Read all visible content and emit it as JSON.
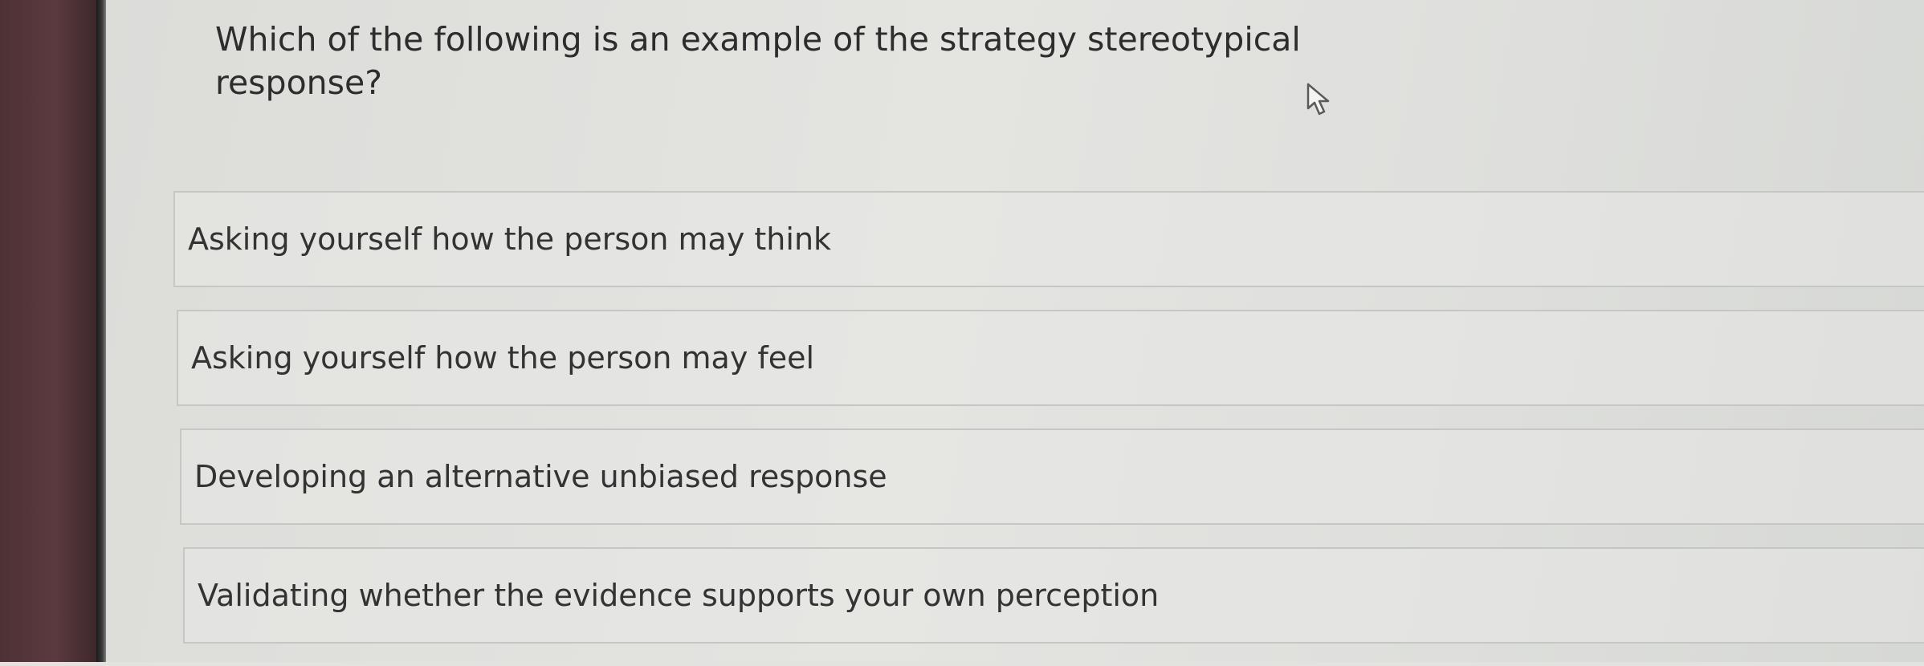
{
  "quiz": {
    "question": "Which of the following is an example of the strategy stereotypical response?",
    "options": [
      {
        "label": "Asking yourself how the person may think"
      },
      {
        "label": "Asking yourself how the person may feel"
      },
      {
        "label": "Developing an alternative unbiased response"
      },
      {
        "label": "Validating whether the evidence supports your own perception"
      }
    ]
  },
  "icons": {
    "cursor": "mouse-pointer-icon"
  },
  "colors": {
    "background": "#e2e2df",
    "option_border": "#c6c7c4",
    "text": "#333333"
  }
}
